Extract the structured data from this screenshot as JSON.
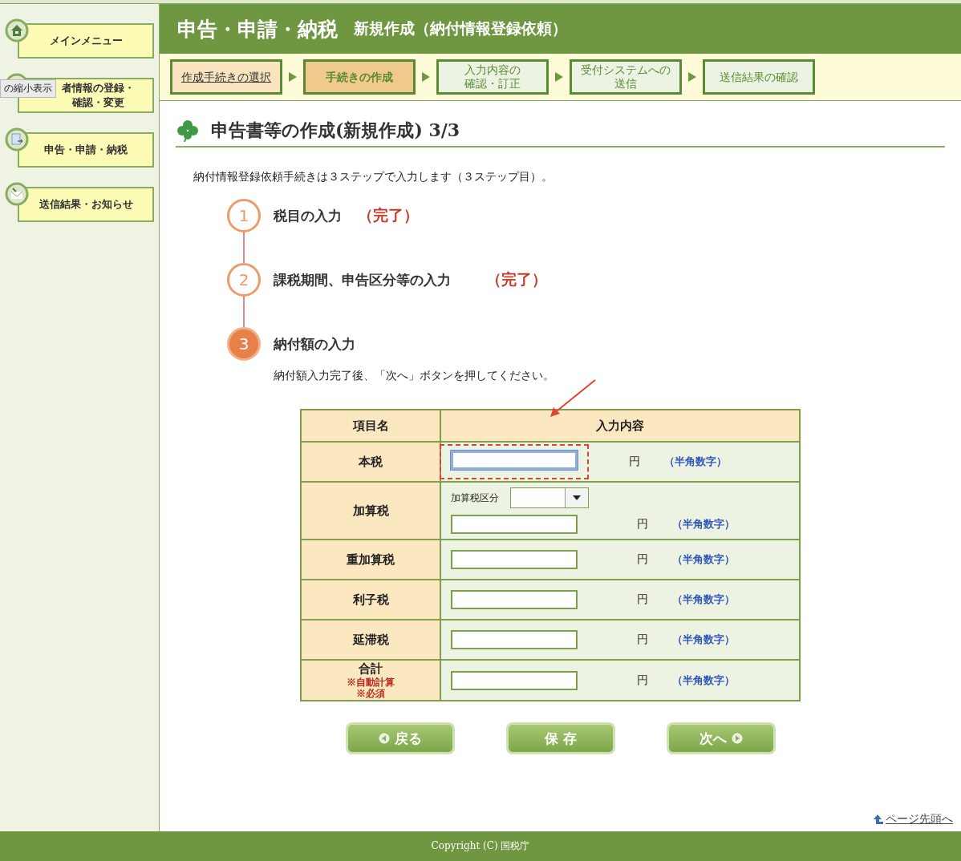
{
  "sidebar": {
    "items": [
      {
        "kind": "home",
        "lines": [
          "メインメニュー"
        ]
      },
      {
        "kind": "user",
        "lines": [
          "者情報の登録・",
          "確認・変更"
        ]
      },
      {
        "kind": "doc",
        "lines": [
          "申告・申請・納税"
        ]
      },
      {
        "kind": "mail",
        "lines": [
          "送信結果・お知らせ"
        ]
      }
    ],
    "tooltip": "の縮小表示"
  },
  "header": {
    "title": "申告・申請・納税",
    "subtitle": "新規作成（納付情報登録依頼）"
  },
  "steps": [
    {
      "lines": [
        "作成手続きの選択"
      ],
      "done": true,
      "selected": false
    },
    {
      "lines": [
        "手続きの作成"
      ],
      "done": false,
      "selected": true
    },
    {
      "lines": [
        "入力内容の",
        "確認・訂正"
      ],
      "done": false,
      "selected": false
    },
    {
      "lines": [
        "受付システムへの",
        "送信"
      ],
      "done": false,
      "selected": false
    },
    {
      "lines": [
        "送信結果の確認"
      ],
      "done": false,
      "selected": false
    }
  ],
  "page_title": "申告書等の作成(新規作成) 3/3",
  "intro": "納付情報登録依頼手続きは３ステップで入力します（３ステップ目）。",
  "progress": [
    {
      "number": "1",
      "label": "税目の入力",
      "status": "（完了）",
      "current": false
    },
    {
      "number": "2",
      "label": "課税期間、申告区分等の入力",
      "status": "（完了）",
      "current": false
    },
    {
      "number": "3",
      "label": "納付額の入力",
      "current": true,
      "note": "納付額入力完了後、「次へ」ボタンを押してください。"
    }
  ],
  "table": {
    "columns": [
      "項目名",
      "入力内容"
    ],
    "rows": [
      {
        "name": "本税",
        "unit": "円",
        "hint": "（半角数字）",
        "focused": true,
        "highlighted": true
      },
      {
        "name": "加算税",
        "select_label": "加算税区分",
        "unit": "円",
        "hint": "（半角数字）",
        "focused": false,
        "highlighted": false
      },
      {
        "name": "重加算税",
        "unit": "円",
        "hint": "（半角数字）",
        "focused": false,
        "highlighted": false
      },
      {
        "name": "利子税",
        "unit": "円",
        "hint": "（半角数字）",
        "focused": false,
        "highlighted": false
      },
      {
        "name": "延滞税",
        "unit": "円",
        "hint": "（半角数字）",
        "focused": false,
        "highlighted": false
      },
      {
        "name": "合計",
        "notes": [
          "※自動計算",
          "※必須"
        ],
        "unit": "円",
        "hint": "（半角数字）",
        "focused": false,
        "highlighted": false
      }
    ]
  },
  "buttons": [
    {
      "label": "戻る",
      "kind": "back"
    },
    {
      "label": "保 存",
      "kind": "save"
    },
    {
      "label": "次へ",
      "kind": "next"
    }
  ],
  "page_top_link": "ページ先頭へ",
  "footer": "Copyright (C) 国税庁"
}
